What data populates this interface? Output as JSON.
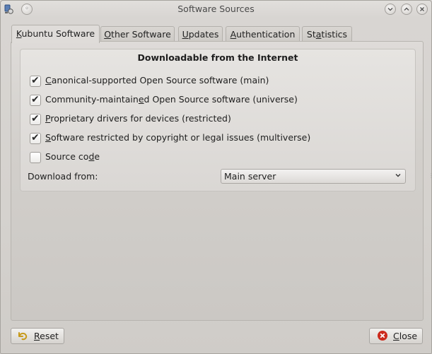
{
  "window": {
    "title": "Software Sources"
  },
  "tabs": [
    {
      "label": "Kubuntu Software",
      "accel_index": 0,
      "active": true
    },
    {
      "label": "Other Software",
      "accel_index": 0,
      "active": false
    },
    {
      "label": "Updates",
      "accel_index": 0,
      "active": false
    },
    {
      "label": "Authentication",
      "accel_index": 0,
      "active": false
    },
    {
      "label": "Statistics",
      "accel_index": 2,
      "active": false
    }
  ],
  "group": {
    "title": "Downloadable from the Internet",
    "options": [
      {
        "label": "Canonical-supported Open Source software (main)",
        "accel_index": 0,
        "checked": true
      },
      {
        "label": "Community-maintained Open Source software (universe)",
        "accel_index": 18,
        "checked": true
      },
      {
        "label": "Proprietary drivers for devices (restricted)",
        "accel_index": 0,
        "checked": true
      },
      {
        "label": "Software restricted by copyright or legal issues (multiverse)",
        "accel_index": 0,
        "checked": true
      },
      {
        "label": "Source code",
        "accel_index": 9,
        "checked": false
      }
    ],
    "download_from": {
      "label": "Download from:",
      "value": "Main server"
    }
  },
  "buttons": {
    "reset": {
      "label": "Reset",
      "accel_index": 0,
      "icon": "undo-icon",
      "icon_color": "#c79a1a"
    },
    "close": {
      "label": "Close",
      "accel_index": 0,
      "icon": "close-icon",
      "icon_color": "#cc2a1c"
    }
  },
  "check_glyph": "✔"
}
